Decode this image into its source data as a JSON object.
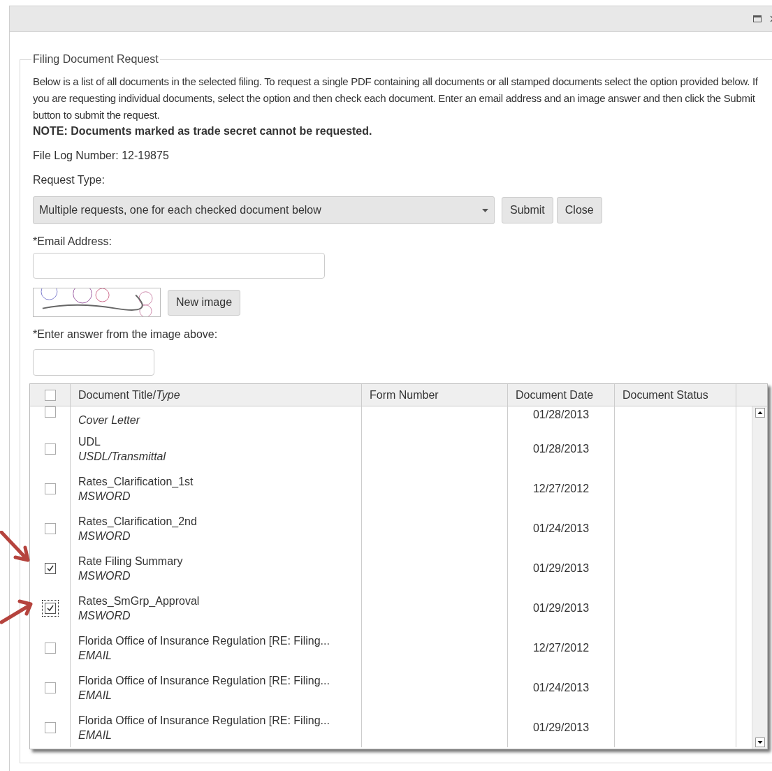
{
  "dialog": {
    "legend": "Filing Document Request",
    "intro": "Below is a list of all documents in the selected filing. To request a single PDF containing all documents or all stamped documents select the option provided below. If you are requesting individual documents, select the option and then check each document. Enter an email address and an image answer and then click the Submit button to submit the request.",
    "note": "NOTE: Documents marked as trade secret cannot be requested.",
    "file_log": "File Log Number: 12-19875",
    "request_type": {
      "label": "Request Type:",
      "value": "Multiple requests, one for each checked document below"
    },
    "buttons": [
      "Submit",
      "Close"
    ],
    "email": {
      "label": "*Email Address:"
    },
    "new_image_button": "New image",
    "answer": {
      "label": "*Enter answer from the image above:"
    }
  },
  "table": {
    "select_all_checked": false,
    "columns": [
      "Document Title/*Type*",
      "Form Number",
      "Document Date",
      "Document Status"
    ],
    "rows": [
      {
        "type": "Cover Letter",
        "date": "01/28/2013",
        "checked": false,
        "focused": false
      },
      {
        "title": "UDL",
        "type": "USDL/Transmittal",
        "date": "01/28/2013",
        "checked": false,
        "focused": false
      },
      {
        "title": "Rates_Clarification_1st",
        "type": "MSWORD",
        "date": "12/27/2012",
        "checked": false,
        "focused": false
      },
      {
        "title": "Rates_Clarification_2nd",
        "type": "MSWORD",
        "date": "01/24/2013",
        "checked": false,
        "focused": false
      },
      {
        "title": "Rate Filing Summary",
        "type": "MSWORD",
        "date": "01/29/2013",
        "checked": true,
        "focused": false
      },
      {
        "title": "Rates_SmGrp_Approval",
        "type": "MSWORD",
        "date": "01/29/2013",
        "checked": true,
        "focused": true
      },
      {
        "title": "Florida Office of Insurance Regulation [RE: Filing...",
        "type": "EMAIL",
        "date": "12/27/2012",
        "checked": false,
        "focused": false
      },
      {
        "title": "Florida Office of Insurance Regulation [RE: Filing...",
        "type": "EMAIL",
        "date": "01/24/2013",
        "checked": false,
        "focused": false
      },
      {
        "title": "Florida Office of Insurance Regulation [RE: Filing...",
        "type": "EMAIL",
        "date": "01/29/2013",
        "checked": false,
        "focused": false
      }
    ]
  }
}
